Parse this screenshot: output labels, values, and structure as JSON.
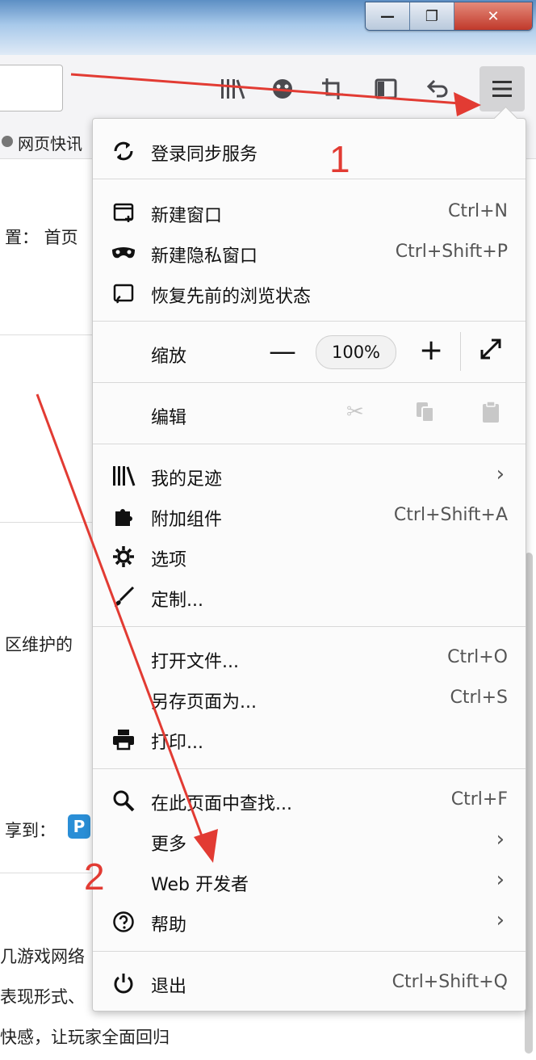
{
  "window": {
    "minimize": "—",
    "maximize": "❐",
    "close": "✕"
  },
  "bookmark_bar": {
    "item": "网页快讯"
  },
  "page": {
    "lines": [
      "置： 首页",
      "区维护的",
      "享到：",
      "几游戏网络",
      "表现形式、",
      "快感，让玩家全面回归"
    ]
  },
  "menu": {
    "sync": "登录同步服务",
    "new_window": {
      "label": "新建窗口",
      "shortcut": "Ctrl+N"
    },
    "new_private": {
      "label": "新建隐私窗口",
      "shortcut": "Ctrl+Shift+P"
    },
    "restore": "恢复先前的浏览状态",
    "zoom": {
      "label": "缩放",
      "minus": "—",
      "value": "100%",
      "plus": "+"
    },
    "edit": "编辑",
    "library": "我的足迹",
    "addons": {
      "label": "附加组件",
      "shortcut": "Ctrl+Shift+A"
    },
    "options": "选项",
    "customize": "定制...",
    "open_file": {
      "label": "打开文件...",
      "shortcut": "Ctrl+O"
    },
    "save_as": {
      "label": "另存页面为...",
      "shortcut": "Ctrl+S"
    },
    "print": "打印...",
    "find": {
      "label": "在此页面中查找...",
      "shortcut": "Ctrl+F"
    },
    "more": "更多",
    "web_dev": "Web 开发者",
    "help": "帮助",
    "quit": {
      "label": "退出",
      "shortcut": "Ctrl+Shift+Q"
    }
  },
  "annotations": {
    "step1": "1",
    "step2": "2"
  },
  "colors": {
    "annotation": "#e23b33",
    "menu_bg": "#fbfbfb"
  }
}
